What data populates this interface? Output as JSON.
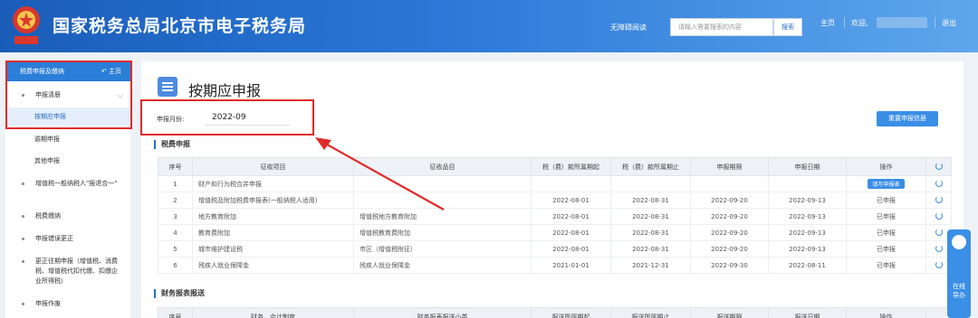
{
  "header": {
    "title": "国家税务总局北京市电子税务局",
    "accessible_read": "无障碍阅读",
    "search_placeholder": "请输入需要搜索的内容",
    "search_button": "搜索",
    "home": "主页",
    "welcome": "欢迎,",
    "logout": "退出",
    "emblem_text": "中国税务"
  },
  "sidebar": {
    "active_header": "税费申报及缴纳",
    "home_link": "主页",
    "declaration_label": "申报清册",
    "sub_items": [
      "按期应申报",
      "逾期申报",
      "其他申报"
    ],
    "items": [
      "增值税一般纳税人\"报退合一\"",
      "税费缴纳",
      "申报错误更正",
      "更正往期申报（增值税、消费税、增值税代扣代缴、扣缴企业所得税）",
      "申报作废"
    ]
  },
  "main": {
    "page_title": "按期应申报",
    "period_label": "申报月份:",
    "period_value": "2022-09",
    "reselect_button": "重置申报信册",
    "section1_title": "税费申报",
    "table1": {
      "headers": [
        "序号",
        "征收项目",
        "征收品目",
        "税（费）款所属期起",
        "税（费）款所属期止",
        "申报期限",
        "申报日期",
        "操作"
      ],
      "rows": [
        [
          "1",
          "财产和行为税合并申报",
          "",
          "",
          "",
          "",
          "",
          "填写申报表"
        ],
        [
          "2",
          "增值税及附加税费申报表(一般纳税人适用)",
          "",
          "2022-08-01",
          "2022-08-31",
          "2022-09-20",
          "2022-09-13",
          "已申报"
        ],
        [
          "3",
          "地方教育附加",
          "增值税地方教育附加",
          "2022-08-01",
          "2022-08-31",
          "2022-09-20",
          "2022-09-13",
          "已申报"
        ],
        [
          "4",
          "教育费附加",
          "增值税教育费附加",
          "2022-08-01",
          "2022-08-31",
          "2022-09-20",
          "2022-09-13",
          "已申报"
        ],
        [
          "5",
          "城市维护建设税",
          "市区（增值税附征）",
          "2022-08-01",
          "2022-08-31",
          "2022-09-20",
          "2022-09-13",
          "已申报"
        ],
        [
          "6",
          "残疾人就业保障金",
          "残疾人就业保障金",
          "2021-01-01",
          "2021-12-31",
          "2022-09-30",
          "2022-08-11",
          "已申报"
        ]
      ]
    },
    "section2_title": "财务报表报送",
    "table2": {
      "headers": [
        "序号",
        "财务、会计制度",
        "财务报表报送小类",
        "报送所属期起",
        "报送所属期止",
        "报送期限",
        "报送日期",
        "操作"
      ]
    }
  },
  "float_widget": {
    "label": "在线导办"
  },
  "colors": {
    "header_blue": "#1a5db8",
    "accent_blue": "#2a7ed8",
    "highlight_red": "#e02a2a"
  }
}
